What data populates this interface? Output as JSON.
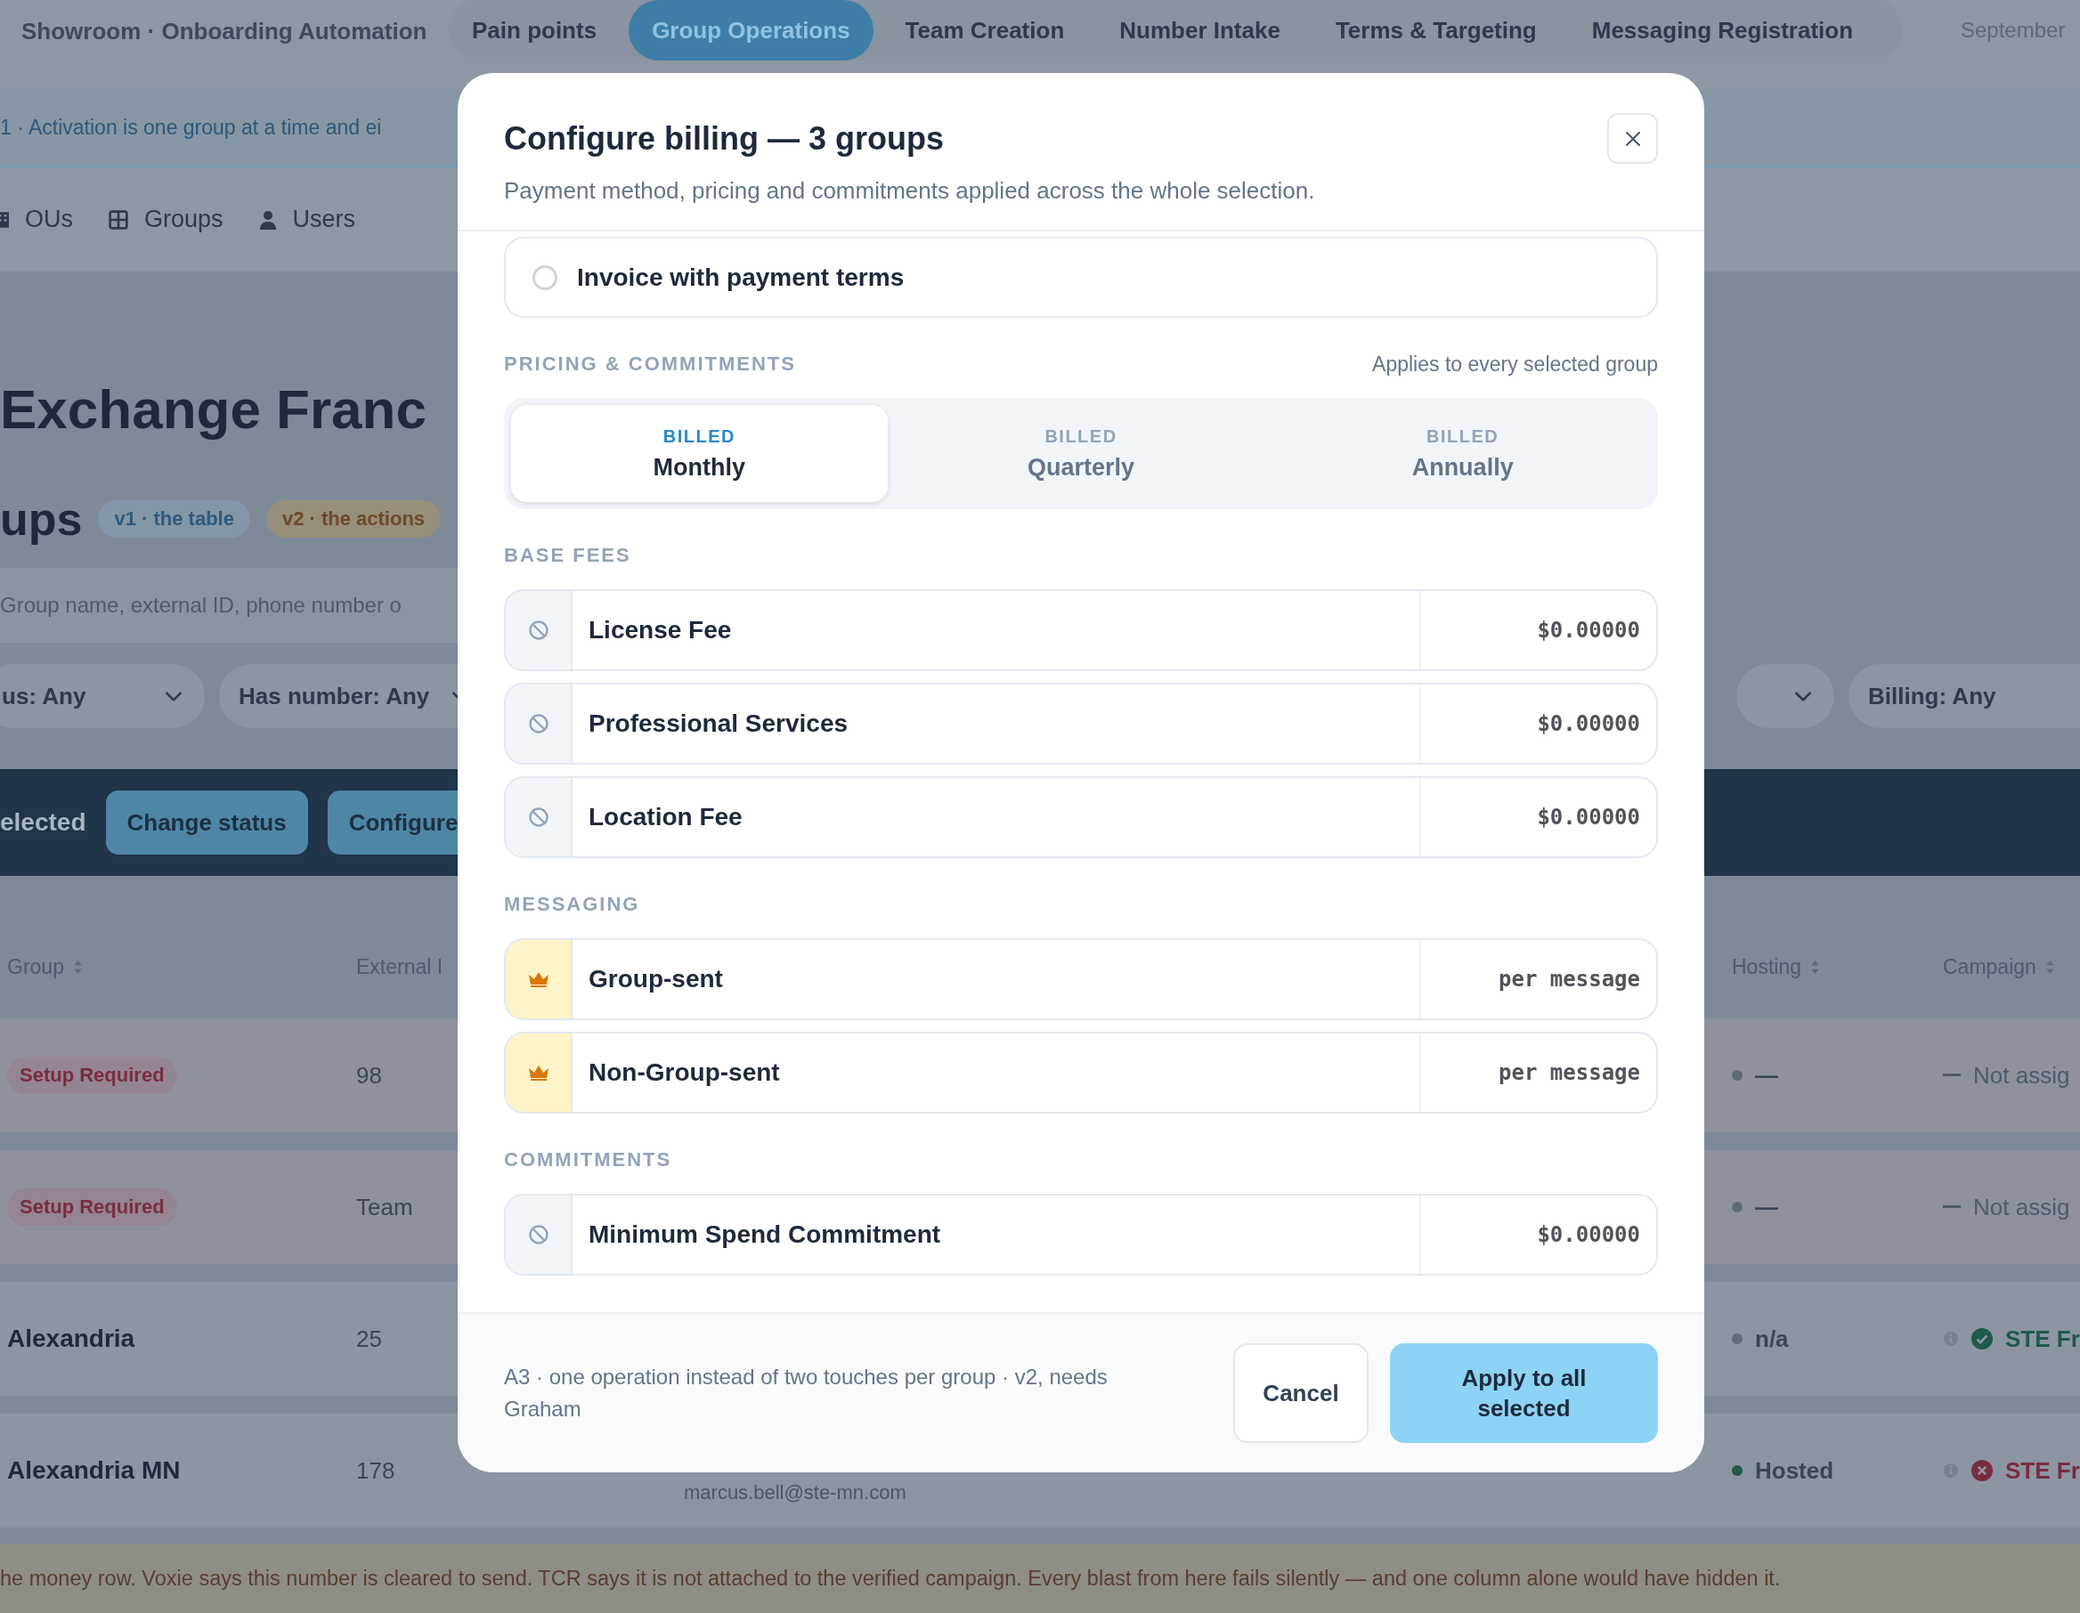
{
  "app": {
    "title": "Showroom · Onboarding Automation",
    "date": "September"
  },
  "nav_tabs": [
    {
      "label": "Pain points",
      "selected": false
    },
    {
      "label": "Group Operations",
      "selected": true
    },
    {
      "label": "Team Creation",
      "selected": false
    },
    {
      "label": "Number Intake",
      "selected": false
    },
    {
      "label": "Terms & Targeting",
      "selected": false
    },
    {
      "label": "Messaging Registration",
      "selected": false
    }
  ],
  "banner": "1 · Activation is one group at a time and ei",
  "sub_nav": [
    {
      "label": "OUs"
    },
    {
      "label": "Groups"
    },
    {
      "label": "Users"
    }
  ],
  "page_title": "Exchange Franc",
  "section": {
    "title": "ups",
    "badges": [
      {
        "text": "v1 · the table",
        "kind": "info"
      },
      {
        "text": "v2 · the actions",
        "kind": "warning"
      }
    ]
  },
  "search": {
    "placeholder": "Group name, external ID, phone number o"
  },
  "filters": {
    "left": [
      "us: Any",
      "Has number: Any"
    ],
    "right": [
      "Billing: Any"
    ]
  },
  "bulk_bar": {
    "selection": "elected",
    "actions": [
      "Change status",
      "Configure"
    ]
  },
  "table": {
    "columns": [
      {
        "label": "Group",
        "sortable": true
      },
      {
        "label": "External I",
        "sortable": false
      },
      {
        "label": "Hosting",
        "sortable": true
      },
      {
        "label": "Campaign",
        "sortable": true
      }
    ],
    "rows": [
      {
        "group": {
          "text": "Setup Required",
          "kind": "badge"
        },
        "external_id": "98",
        "hosting": {
          "text": "—",
          "color": "#5f6b7a"
        },
        "campaign": {
          "text": "Not assig",
          "kind": "none"
        }
      },
      {
        "group": {
          "text": "Setup Required",
          "kind": "badge"
        },
        "external_id": "Team",
        "hosting": {
          "text": "—",
          "color": "#5f6b7a"
        },
        "campaign": {
          "text": "Not assig",
          "kind": "none"
        }
      },
      {
        "group": {
          "text": "Alexandria",
          "kind": "name"
        },
        "external_id": "25",
        "hosting": {
          "text": "n/a",
          "color": "#5f6b7a"
        },
        "campaign": {
          "text": "STE Fr",
          "kind": "verified"
        }
      },
      {
        "group": {
          "text": "Alexandria MN",
          "kind": "name"
        },
        "external_id": "178",
        "contact": "marcus.bell@ste-mn.com",
        "hosting": {
          "text": "Hosted",
          "color": "#1f5a4a"
        },
        "campaign": {
          "text": "STE Fr",
          "kind": "failed"
        }
      }
    ]
  },
  "footer_note": "he money row. Voxie says this number is cleared to send. TCR says it is not attached to the verified campaign. Every blast from here fails silently — and one column alone would have hidden it.",
  "modal": {
    "title": "Configure billing — 3 groups",
    "subtitle": "Payment method, pricing and commitments applied across the whole selection.",
    "payment_option": {
      "label": "Invoice with payment terms",
      "selected": false
    },
    "pricing": {
      "heading": "PRICING & COMMITMENTS",
      "note": "Applies to every selected group",
      "periods": [
        {
          "caption": "BILLED",
          "label": "Monthly",
          "selected": true
        },
        {
          "caption": "BILLED",
          "label": "Quarterly",
          "selected": false
        },
        {
          "caption": "BILLED",
          "label": "Annually",
          "selected": false
        }
      ]
    },
    "groups": [
      {
        "heading": "BASE FEES",
        "items": [
          {
            "label": "License Fee",
            "value": "$0.00000",
            "kind": "blocked"
          },
          {
            "label": "Professional Services",
            "value": "$0.00000",
            "kind": "blocked"
          },
          {
            "label": "Location Fee",
            "value": "$0.00000",
            "kind": "blocked"
          }
        ]
      },
      {
        "heading": "MESSAGING",
        "items": [
          {
            "label": "Group-sent",
            "value": "per message",
            "kind": "premium"
          },
          {
            "label": "Non-Group-sent",
            "value": "per message",
            "kind": "premium"
          }
        ]
      },
      {
        "heading": "COMMITMENTS",
        "items": [
          {
            "label": "Minimum Spend Commitment",
            "value": "$0.00000",
            "kind": "blocked"
          }
        ]
      }
    ],
    "footer_note": "A3 · one operation instead of two touches per group · v2, needs Graham",
    "buttons": [
      {
        "label": "Cancel",
        "kind": "secondary"
      },
      {
        "label": "Apply to all selected",
        "kind": "primary"
      }
    ]
  }
}
